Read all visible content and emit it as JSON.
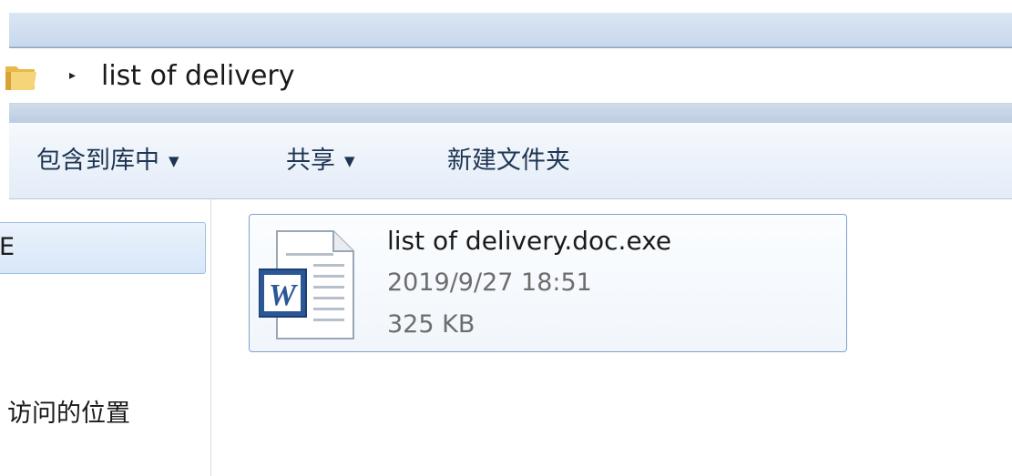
{
  "address_bar": {
    "folder_icon": "folder-icon",
    "path_arrow": "▸",
    "path": "list of delivery"
  },
  "toolbar": {
    "include_in_library": "包含到库中",
    "share": "共享",
    "new_folder": "新建文件夹",
    "dropdown_caret": "▼"
  },
  "nav_pane": {
    "items": [
      {
        "label": "E"
      },
      {
        "label": ""
      },
      {
        "label": ""
      },
      {
        "label": "访问的位置"
      }
    ]
  },
  "content": {
    "files": [
      {
        "name": "list of delivery.doc.exe",
        "date": "2019/9/27 18:51",
        "size": "325 KB",
        "icon": "word-document-icon"
      }
    ]
  },
  "colors": {
    "selection_border": "#7da2ce",
    "toolbar_text": "#1e3553",
    "secondary_text": "#6d6d6d"
  }
}
